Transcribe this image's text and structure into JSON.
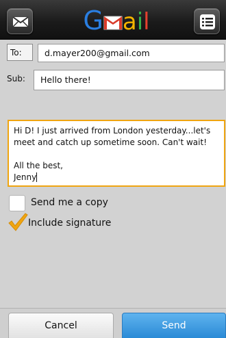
{
  "header": {
    "logo_text": "Gmail",
    "left_icon": "envelope-icon",
    "right_icon": "menu-list-icon"
  },
  "compose": {
    "to_label": "To:",
    "to_value": "d.mayer200@gmail.com",
    "subject_label": "Sub:",
    "subject_value": "Hello there!",
    "body_lines": [
      "Hi D! I just arrived from London yesterday...let's",
      "meet and catch up sometime soon. Can't wait!",
      "",
      "All the best,",
      "Jenny"
    ]
  },
  "options": [
    {
      "label": "Send me a copy",
      "checked": false
    },
    {
      "label": "Include signature",
      "checked": true
    }
  ],
  "actions": {
    "cancel_label": "Cancel",
    "send_label": "Send"
  },
  "colors": {
    "focus_border": "#f0a510",
    "send_button": "#2a8ad6",
    "checkmark": "#f0a510"
  }
}
